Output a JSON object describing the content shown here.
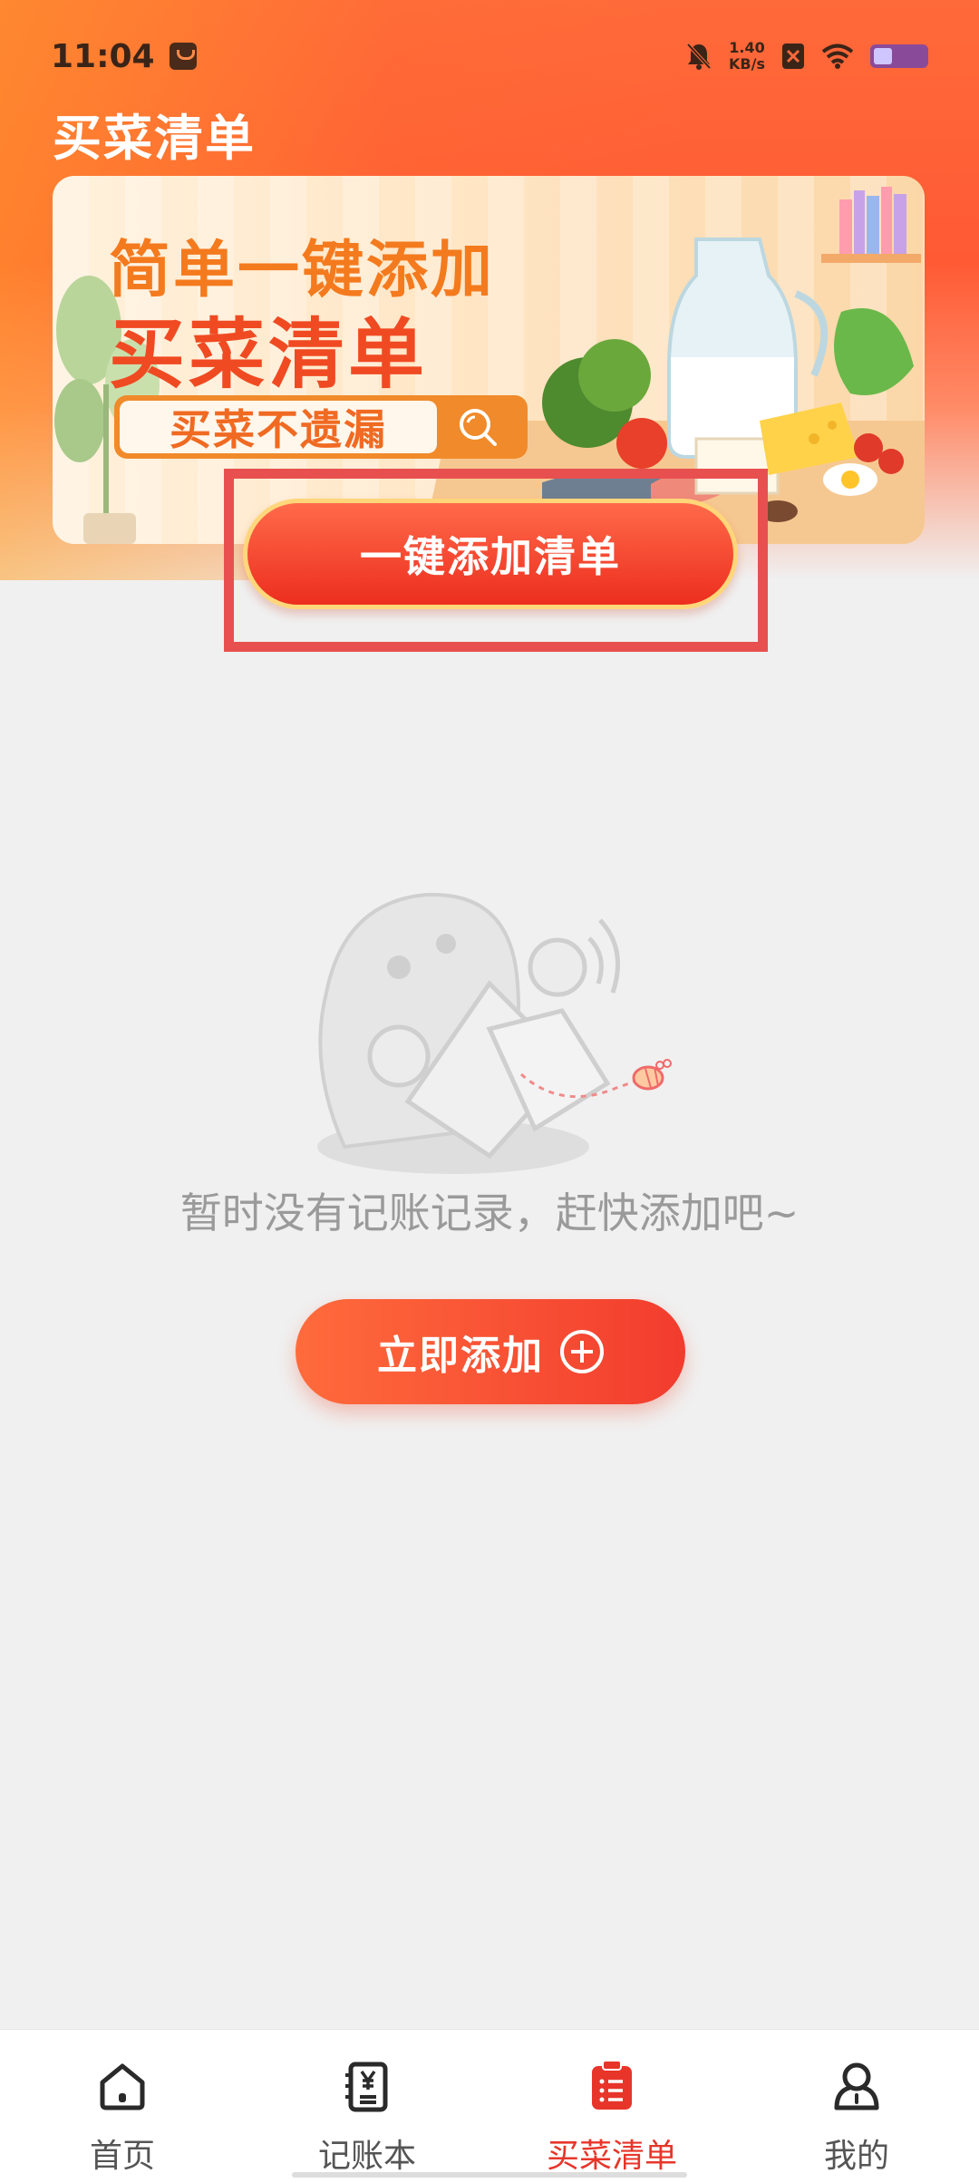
{
  "status_bar": {
    "time": "11:04",
    "net_speed_value": "1.40",
    "net_speed_unit": "KB/s"
  },
  "page_title": "买菜清单",
  "banner": {
    "headline_line1": "简单一键添加",
    "headline_line2": "买菜清单",
    "search_text": "买菜不遗漏"
  },
  "cta_button_label": "一键添加清单",
  "empty_state": {
    "message": "暂时没有记账记录，赶快添加吧~",
    "add_button_label": "立即添加"
  },
  "bottom_nav": {
    "items": [
      {
        "label": "首页",
        "icon": "home-icon",
        "active": false
      },
      {
        "label": "记账本",
        "icon": "ledger-icon",
        "active": false
      },
      {
        "label": "买菜清单",
        "icon": "clipboard-list-icon",
        "active": true
      },
      {
        "label": "我的",
        "icon": "user-icon",
        "active": false
      }
    ]
  },
  "colors": {
    "accent": "#e8352a",
    "highlight_border": "#e85050",
    "background": "#f0f0f0"
  }
}
